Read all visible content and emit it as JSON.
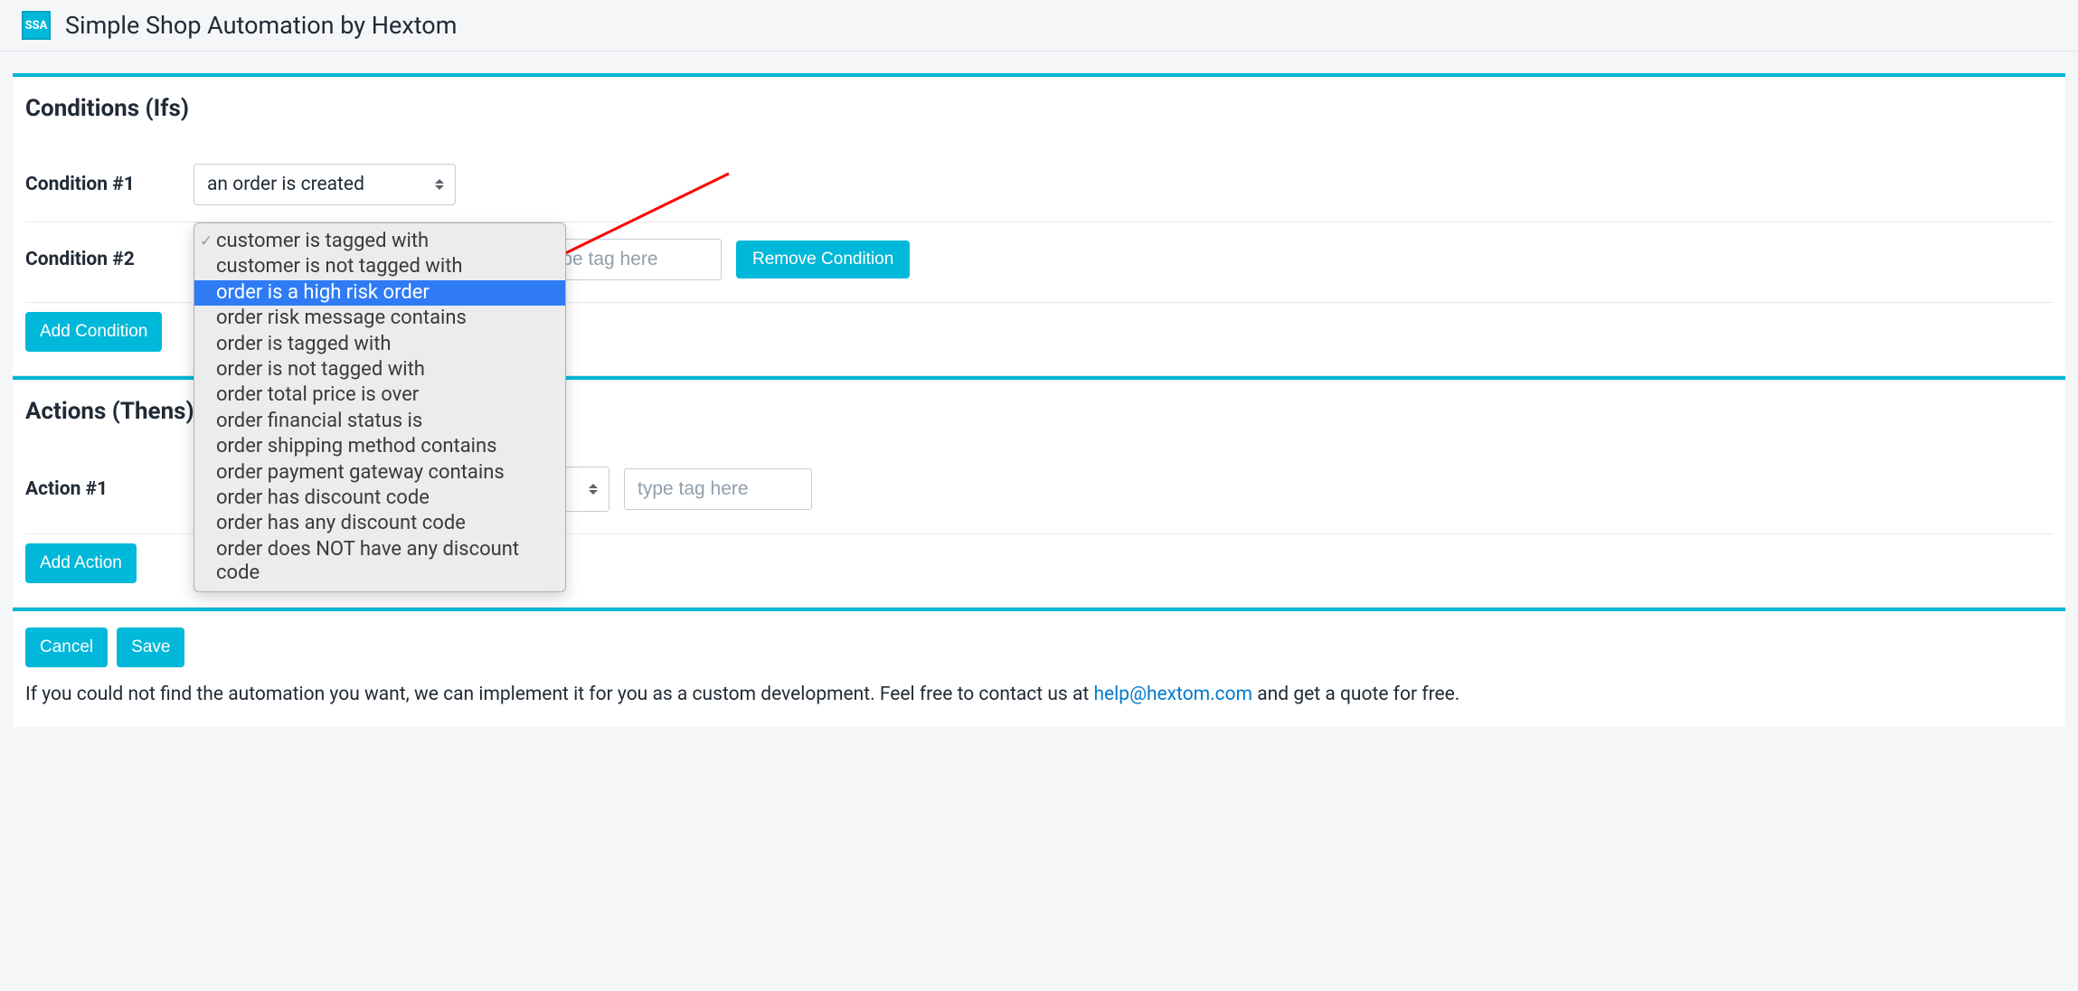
{
  "header": {
    "logo_text": "SSA",
    "title": "Simple Shop Automation by Hextom"
  },
  "conditions": {
    "title": "Conditions (Ifs)",
    "rows": [
      {
        "label": "Condition #1",
        "select_value": "an order is created"
      },
      {
        "label": "Condition #2",
        "tag_placeholder": "type tag here",
        "remove_label": "Remove Condition"
      }
    ],
    "add_label": "Add Condition",
    "dropdown": {
      "options": [
        "customer is tagged with",
        "customer is not tagged with",
        "order is a high risk order",
        "order risk message contains",
        "order is tagged with",
        "order is not tagged with",
        "order total price is over",
        "order financial status is",
        "order shipping method contains",
        "order payment gateway contains",
        "order has discount code",
        "order has any discount code",
        "order does NOT have any discount code"
      ],
      "checked_index": 0,
      "highlighted_index": 2
    }
  },
  "actions": {
    "title": "Actions (Thens)",
    "rows": [
      {
        "label": "Action #1",
        "tag_placeholder": "type tag here"
      }
    ],
    "add_label": "Add Action"
  },
  "footer": {
    "cancel_label": "Cancel",
    "save_label": "Save",
    "text_before": "If you could not find the automation you want, we can implement it for you as a custom development. Feel free to contact us at ",
    "email": "help@hextom.com",
    "text_after": " and get a quote for free."
  }
}
